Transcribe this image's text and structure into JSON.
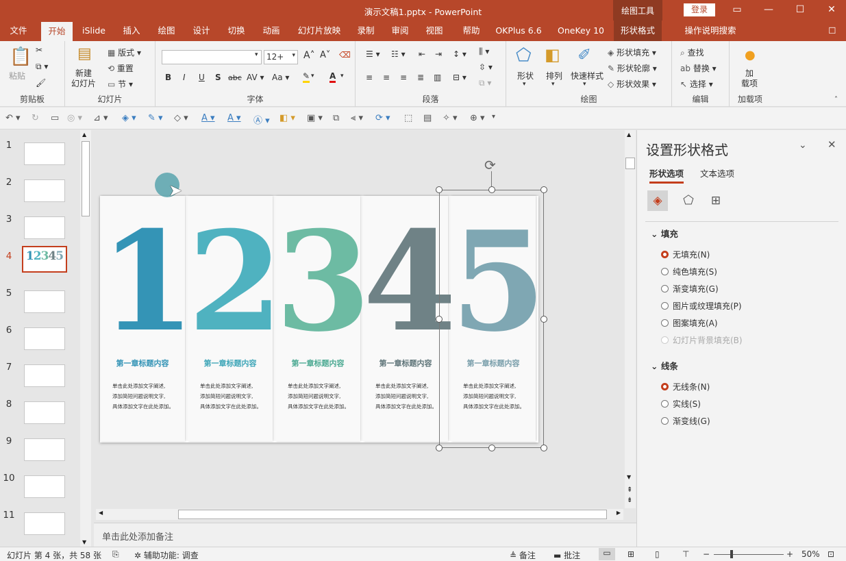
{
  "window": {
    "title": "演示文稿1.pptx  -  PowerPoint",
    "context_tab_group": "绘图工具",
    "login": "登录"
  },
  "tabs": [
    {
      "label": "文件"
    },
    {
      "label": "开始",
      "active": true
    },
    {
      "label": "iSlide"
    },
    {
      "label": "插入"
    },
    {
      "label": "绘图"
    },
    {
      "label": "设计"
    },
    {
      "label": "切换"
    },
    {
      "label": "动画"
    },
    {
      "label": "幻灯片放映"
    },
    {
      "label": "录制"
    },
    {
      "label": "审阅"
    },
    {
      "label": "视图"
    },
    {
      "label": "帮助"
    },
    {
      "label": "OKPlus 6.6"
    },
    {
      "label": "OneKey 10"
    },
    {
      "label": "形状格式"
    },
    {
      "label": "操作说明搜索"
    }
  ],
  "ribbon": {
    "clipboard": {
      "label": "剪贴板",
      "paste": "粘贴"
    },
    "slides": {
      "label": "幻灯片",
      "new_slide": "新建\n幻灯片",
      "layout": "版式",
      "reset": "重置",
      "section": "节"
    },
    "font": {
      "label": "字体",
      "font_name": "",
      "font_size": "12+",
      "bold": "B",
      "italic": "I",
      "underline": "U",
      "shadow": "S",
      "strike": "abc",
      "spacing": "AV",
      "case": "Aa"
    },
    "paragraph": {
      "label": "段落"
    },
    "drawing": {
      "label": "绘图",
      "shapes": "形状",
      "arrange": "排列",
      "quick_styles": "快速样式",
      "shape_fill": "形状填充",
      "shape_outline": "形状轮廓",
      "shape_effects": "形状效果"
    },
    "editing": {
      "label": "编辑",
      "find": "查找",
      "replace": "替换",
      "select": "选择"
    },
    "addins": {
      "label": "加载项",
      "add": "加\n载项"
    }
  },
  "thumbnails": [
    "1",
    "2",
    "3",
    "4",
    "5",
    "6",
    "7",
    "8",
    "9",
    "10",
    "11"
  ],
  "selected_slide": "4",
  "slide": {
    "cards": [
      {
        "digit": "1",
        "color": "#3494b6",
        "caption": "第一章标题内容",
        "caption_color": "#3494b6",
        "desc": [
          "单击此处添加文字阐述,",
          "添加简短问题说明文字,",
          "具体添加文字在此处添加。"
        ]
      },
      {
        "digit": "2",
        "color": "#4fb2c0",
        "caption": "第一章标题内容",
        "caption_color": "#3fa6b8",
        "desc": [
          "单击此处添加文字阐述,",
          "添加简短问题说明文字,",
          "具体添加文字在此处添加。"
        ]
      },
      {
        "digit": "3",
        "color": "#6dbba3",
        "caption": "第一章标题内容",
        "caption_color": "#4daa93",
        "desc": [
          "单击此处添加文字阐述,",
          "添加简短问题说明文字,",
          "具体添加文字在此处添加。"
        ]
      },
      {
        "digit": "4",
        "color": "#6f8286",
        "caption": "第一章标题内容",
        "caption_color": "#5f7579",
        "desc": [
          "单击此处添加文字阐述,",
          "添加简短问题说明文字,",
          "具体添加文字在此处添加。"
        ]
      },
      {
        "digit": "5",
        "color": "#7fa7b3",
        "caption": "第一章标题内容",
        "caption_color": "#7a9fab",
        "desc": [
          "单击此处添加文字阐述,",
          "添加简短问题说明文字,",
          "具体添加文字在此处添加。"
        ]
      }
    ]
  },
  "notes_placeholder": "单击此处添加备注",
  "format_pane": {
    "title": "设置形状格式",
    "tabs": [
      "形状选项",
      "文本选项"
    ],
    "fill_section": "填充",
    "fill_options": [
      {
        "label": "无填充(N)",
        "checked": true,
        "disabled": false
      },
      {
        "label": "纯色填充(S)",
        "checked": false,
        "disabled": false
      },
      {
        "label": "渐变填充(G)",
        "checked": false,
        "disabled": false
      },
      {
        "label": "图片或纹理填充(P)",
        "checked": false,
        "disabled": false
      },
      {
        "label": "图案填充(A)",
        "checked": false,
        "disabled": false
      },
      {
        "label": "幻灯片背景填充(B)",
        "checked": false,
        "disabled": true
      }
    ],
    "line_section": "线条",
    "line_options": [
      {
        "label": "无线条(N)",
        "checked": true
      },
      {
        "label": "实线(S)",
        "checked": false
      },
      {
        "label": "渐变线(G)",
        "checked": false
      }
    ]
  },
  "status": {
    "slide_info": "幻灯片 第 4 张，共 58 张",
    "accessibility": "辅助功能: 调查",
    "notes": "备注",
    "comments": "批注",
    "zoom": "50%"
  }
}
